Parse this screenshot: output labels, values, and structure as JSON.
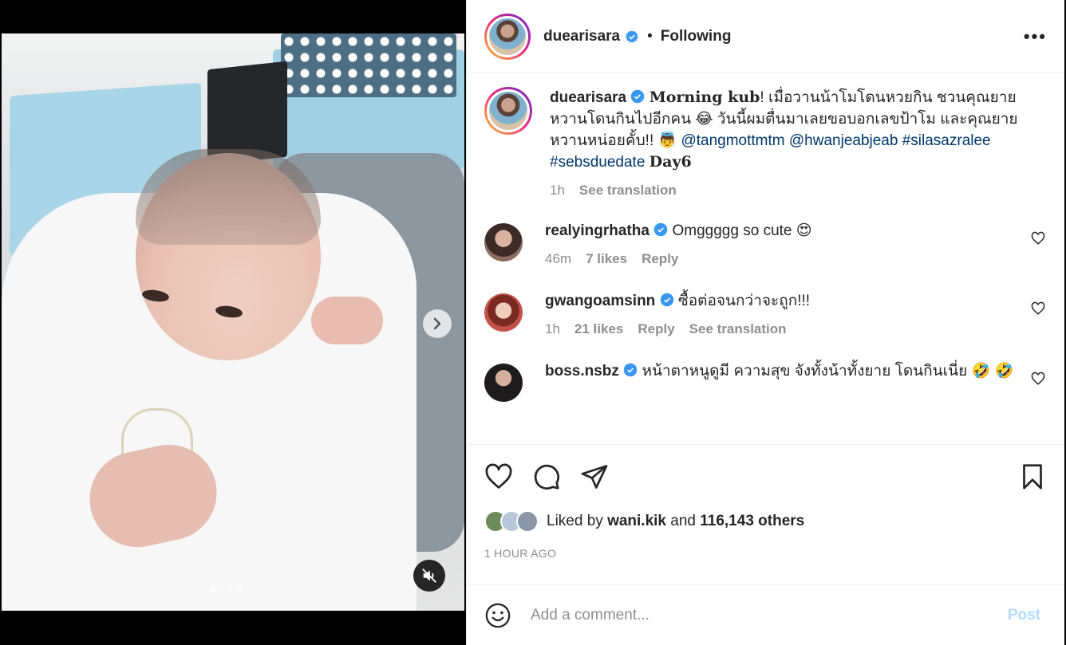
{
  "post": {
    "username": "duearisara",
    "following_label": "Following",
    "more_label": "•••",
    "separator": "•"
  },
  "caption": {
    "username": "duearisara",
    "bold_start": "Morning kub",
    "text_1": "! เมื่อวานน้าโมโดนหวยกิน ชวนคุณยายหวานโดนกินไปอีกคน 😂 วันนี้ผมตื่นมาเลยขอบอกเลขป้าโม และคุณยายหวานหน่อยคั้บ!! 👼 ",
    "mention_1": "@tangmottmtm",
    "mention_2": "@hwanjeabjeab",
    "hashtag_1": "#silasazralee",
    "hashtag_2": "#sebsduedate",
    "bold_end": "Day6",
    "time": "1h",
    "translate": "See translation"
  },
  "comments": [
    {
      "username": "realyingrhatha",
      "text": "Omggggg so cute 😍",
      "time": "46m",
      "likes": "7 likes",
      "reply": "Reply",
      "translate": "",
      "avatar_color": "#6b4b42"
    },
    {
      "username": "gwangoamsinn",
      "text": "ซื้อต่อจนกว่าจะถูก!!!",
      "time": "1h",
      "likes": "21 likes",
      "reply": "Reply",
      "translate": "See translation",
      "avatar_color": "#c4524a"
    },
    {
      "username": "boss.nsbz",
      "text": "หน้าตาหนูดูมี ความสุข จังทั้งน้าทั้งยาย โดนกินเนี่ย 🤣 🤣",
      "time": "",
      "likes": "",
      "reply": "",
      "translate": "",
      "avatar_color": "#2f2b2c"
    }
  ],
  "likes": {
    "prefix": "Liked by",
    "user": "wani.kik",
    "and": "and",
    "others": "116,143 others"
  },
  "timestamp": "1 HOUR AGO",
  "comment_box": {
    "placeholder": "Add a comment...",
    "post_label": "Post"
  },
  "icons": {
    "like": "heart-icon",
    "comment": "comment-icon",
    "share": "paper-plane-icon",
    "save": "bookmark-icon",
    "emoji": "emoji-icon",
    "next": "chevron-right-icon",
    "mute": "muted-speaker-icon"
  },
  "colors": {
    "verified": "#3897f0",
    "link": "#00376b",
    "post_disabled": "#b3dbff",
    "muted_text": "#8e8e8e"
  }
}
